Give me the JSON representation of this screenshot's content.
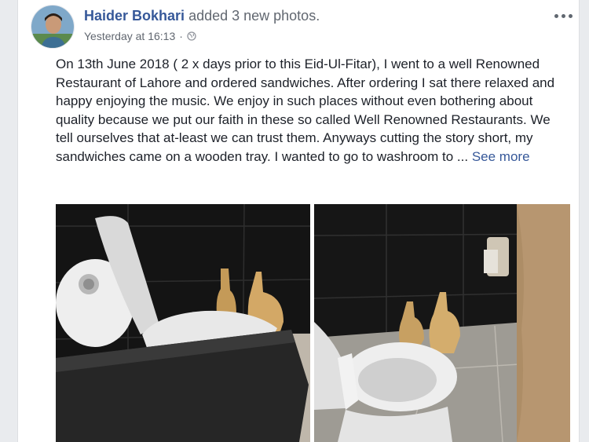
{
  "post": {
    "author": "Haider Bokhari",
    "action": "added 3 new photos.",
    "timestamp": "Yesterday at 16:13",
    "separator": "·",
    "privacy_icon": "globe-icon",
    "menu_icon": "more-dots-icon",
    "text": "On 13th June 2018 ( 2 x days prior to this Eid-Ul-Fitar), I went to a well Renowned Restaurant of Lahore and ordered sandwiches. After ordering I sat there relaxed and happy enjoying the music. We enjoy in such places without even bothering about quality because we put our faith in these so called Well Renowned Restaurants. We tell ourselves that at-least we can trust them. Anyways cutting the story short, my sandwiches came on a wooden tray. I wanted to go to washroom to ...",
    "see_more": "See more"
  },
  "colors": {
    "author_link": "#365899",
    "meta_text": "#616770",
    "background": "#e9ebee",
    "card": "#ffffff"
  }
}
